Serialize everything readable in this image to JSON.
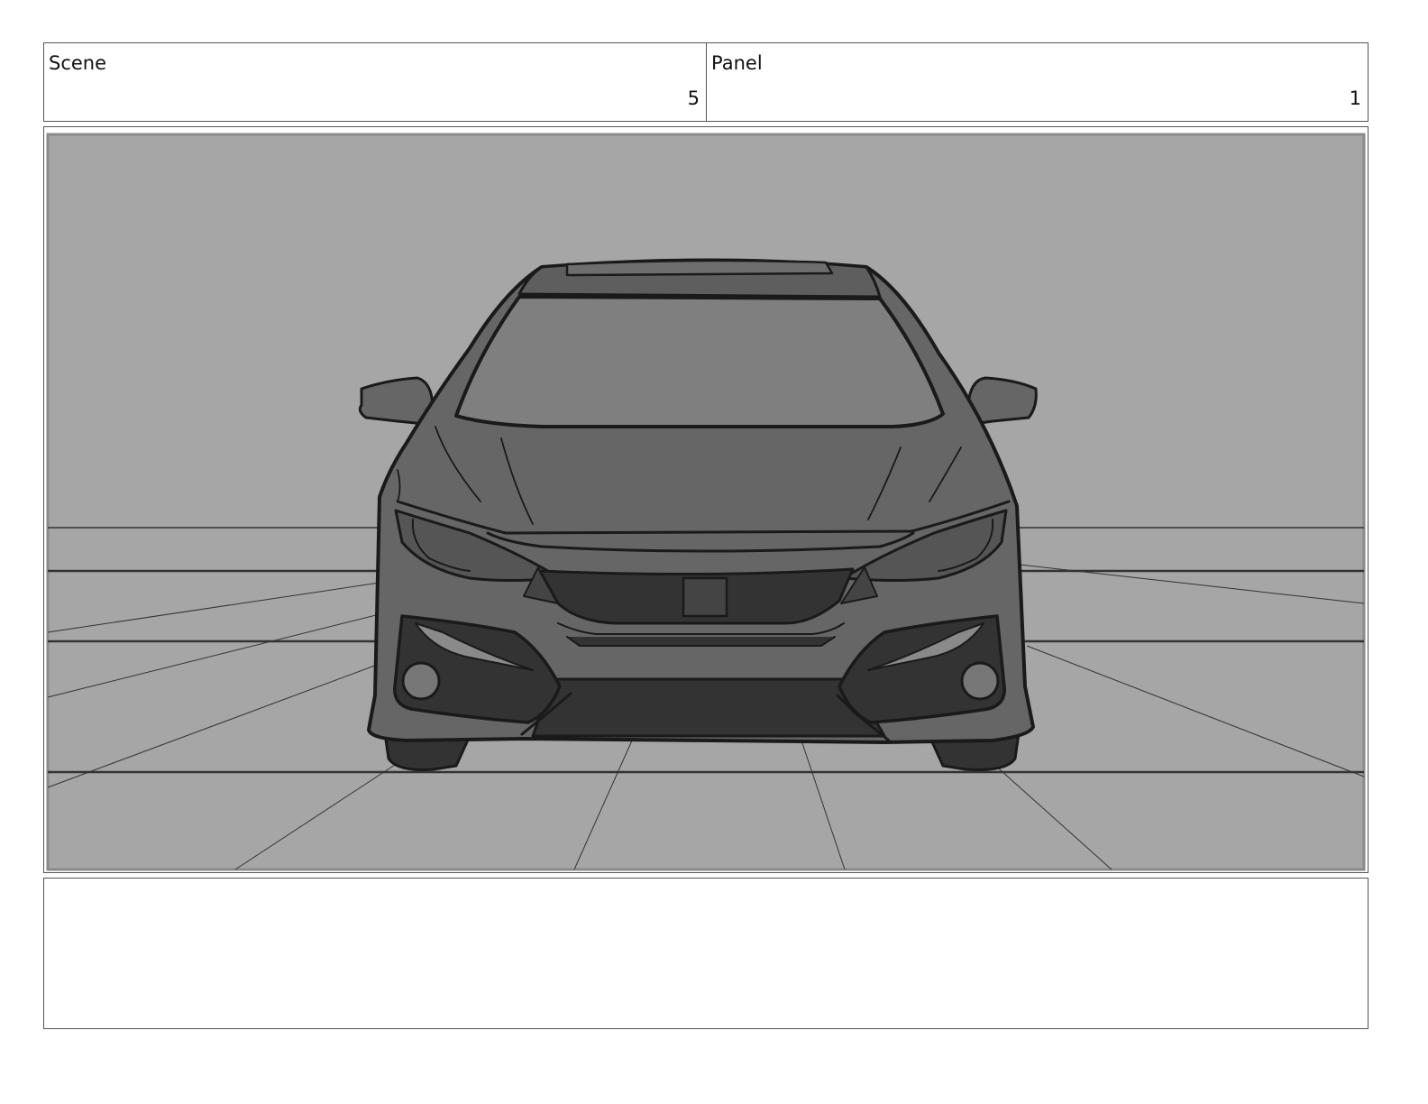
{
  "header": {
    "scene_label": "Scene",
    "scene_value": "5",
    "panel_label": "Panel",
    "panel_value": "1"
  },
  "frame": {
    "subject": "car-front-sketch",
    "background_color": "#a6a6a6",
    "body_color": "#666666",
    "glass_color": "#7f7f7f",
    "dark_color": "#333333",
    "line_color": "#1a1a1a"
  },
  "notes": {
    "text": ""
  }
}
